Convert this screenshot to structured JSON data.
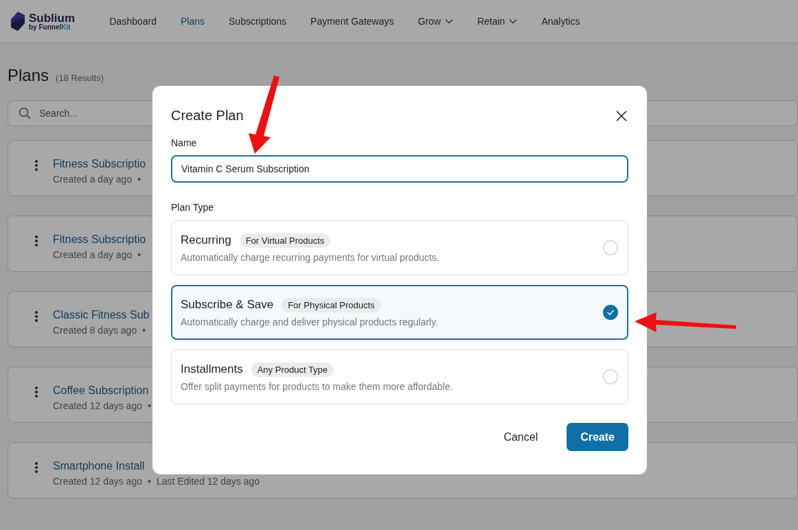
{
  "header": {
    "logo": {
      "name": "Sublium",
      "tagline_prefix": "by Funnel",
      "tagline_accent": "Kit"
    },
    "nav": [
      {
        "label": "Dashboard",
        "selected": false,
        "dropdown": false
      },
      {
        "label": "Plans",
        "selected": true,
        "dropdown": false
      },
      {
        "label": "Subscriptions",
        "selected": false,
        "dropdown": false
      },
      {
        "label": "Payment Gateways",
        "selected": false,
        "dropdown": false
      },
      {
        "label": "Grow",
        "selected": false,
        "dropdown": true
      },
      {
        "label": "Retain",
        "selected": false,
        "dropdown": true
      },
      {
        "label": "Analytics",
        "selected": false,
        "dropdown": false
      }
    ]
  },
  "page": {
    "title": "Plans",
    "count": "(18 Results)",
    "search": {
      "placeholder": "Search..."
    },
    "plans": [
      {
        "title": "Fitness Subscriptio",
        "meta": [
          "Created a day ago",
          "•"
        ]
      },
      {
        "title": "Fitness Subscriptio",
        "meta": [
          "Created a day ago",
          "•"
        ]
      },
      {
        "title": "Classic Fitness Sub",
        "meta": [
          "Created 8 days ago",
          "•"
        ]
      },
      {
        "title": "Coffee Subscription",
        "meta": [
          "Created 12 days ago",
          "•"
        ]
      },
      {
        "title": "Smartphone Install",
        "meta": [
          "Created 12 days ago",
          "•",
          "Last Edited 12 days ago"
        ]
      }
    ]
  },
  "dialog": {
    "title": "Create Plan",
    "name_label": "Name",
    "name_value": "Vitamin C Serum Subscription",
    "type_label": "Plan Type",
    "options": [
      {
        "title": "Recurring",
        "tag": "For Virtual Products",
        "description": "Automatically charge recurring payments for virtual products.",
        "selected": false
      },
      {
        "title": "Subscribe & Save",
        "tag": "For Physical Products",
        "description": "Automatically charge and deliver physical products regularly.",
        "selected": true
      },
      {
        "title": "Installments",
        "tag": "Any Product Type",
        "description": "Offer split payments for products to make them more affordable.",
        "selected": false
      }
    ],
    "buttons": [
      {
        "label": "Cancel",
        "kind": "secondary"
      },
      {
        "label": "Create",
        "kind": "primary"
      }
    ]
  }
}
